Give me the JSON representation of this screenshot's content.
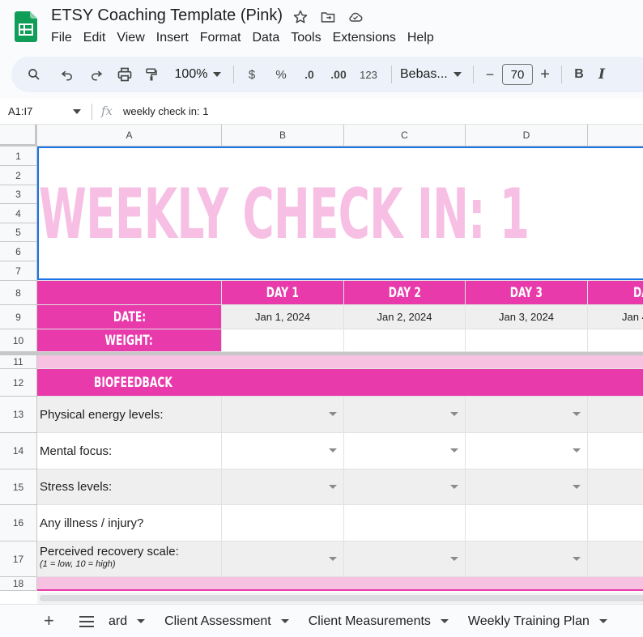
{
  "app": {
    "doc_title": "ETSY Coaching Template (Pink)",
    "menu": [
      "File",
      "Edit",
      "View",
      "Insert",
      "Format",
      "Data",
      "Tools",
      "Extensions",
      "Help"
    ],
    "brand_color": "#0f9d58"
  },
  "toolbar": {
    "zoom": "100%",
    "currency": "$",
    "percent": "%",
    "decrease_decimal": ".0",
    "increase_decimal": ".00",
    "number_format": "123",
    "font": "Bebas...",
    "minus": "−",
    "font_size": "70",
    "plus": "+",
    "bold": "B",
    "italic": "I"
  },
  "formula_bar": {
    "name_box": "A1:I7",
    "fx": "fx",
    "formula": "weekly check in: 1"
  },
  "grid": {
    "columns": [
      "A",
      "B",
      "C",
      "D"
    ],
    "rows": [
      "1",
      "2",
      "3",
      "4",
      "5",
      "6",
      "7",
      "8",
      "9",
      "10",
      "11",
      "12",
      "13",
      "14",
      "15",
      "16",
      "17",
      "18"
    ],
    "title": "WEEKLY CHECK IN: 1",
    "days": [
      "DAY 1",
      "DAY 2",
      "DAY 3",
      "DA"
    ],
    "date_label": "DATE:",
    "dates": [
      "Jan 1, 2024",
      "Jan 2, 2024",
      "Jan 3, 2024",
      "Jan 4"
    ],
    "weight_label": "WEIGHT:",
    "section": "BIOFEEDBACK",
    "items": [
      {
        "label": "Physical energy levels:",
        "dropdown": true
      },
      {
        "label": "Mental focus:",
        "dropdown": true
      },
      {
        "label": "Stress levels:",
        "dropdown": true
      },
      {
        "label": "Any illness / injury?",
        "dropdown": false
      },
      {
        "label": "Perceived recovery scale:",
        "note": "(1 = low, 10 = high)",
        "dropdown": true
      }
    ],
    "colors": {
      "pink": "#e83aab",
      "light_pink": "#f7c2e1",
      "title_pink": "#f6bfe3"
    }
  },
  "sheets": {
    "partial": "ard",
    "tabs": [
      "Client Assessment",
      "Client Measurements",
      "Weekly Training Plan"
    ]
  }
}
